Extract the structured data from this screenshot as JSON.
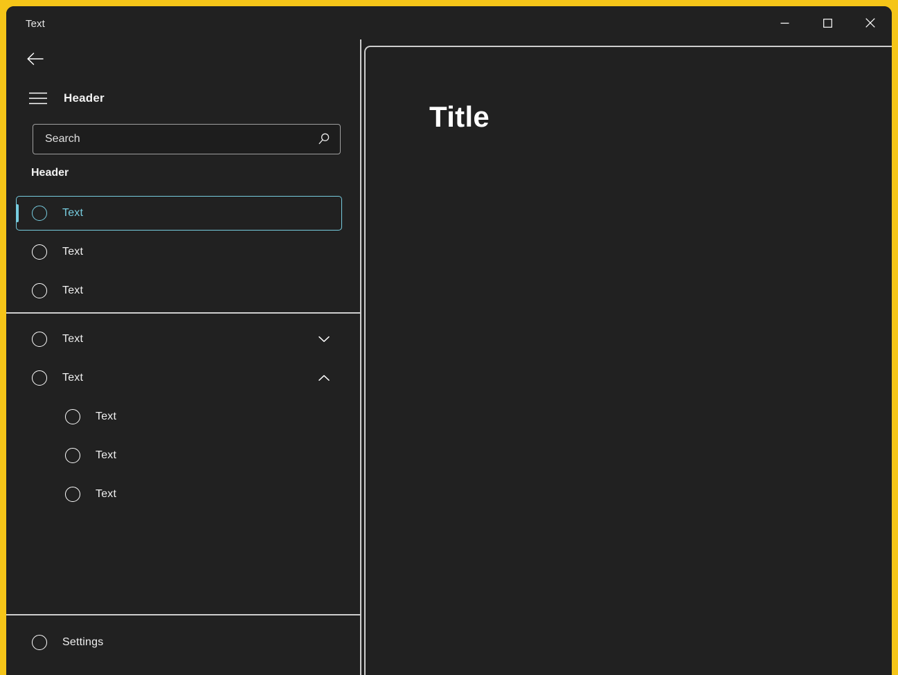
{
  "window": {
    "title": "Text",
    "frame_color": "#f5c518",
    "background": "#212121",
    "accent_color": "#77cde0",
    "border_color": "#cfcfcf",
    "caption_buttons": [
      {
        "name": "minimize",
        "icon": "minimize-icon",
        "label": "Minimize"
      },
      {
        "name": "maximize",
        "icon": "maximize-icon",
        "label": "Maximize"
      },
      {
        "name": "close",
        "icon": "close-icon",
        "label": "Close"
      }
    ]
  },
  "sidebar": {
    "back_button": {
      "icon": "back-arrow-icon",
      "label": "Back"
    },
    "hamburger_button": {
      "icon": "hamburger-icon",
      "label": "Navigation"
    },
    "nav_header": "Header",
    "search": {
      "placeholder": "Search",
      "value": "",
      "icon": "search-icon"
    },
    "section_header": "Header",
    "primary_items": [
      {
        "label": "Text",
        "icon": "circle-icon",
        "selected": true,
        "expandable": false
      },
      {
        "label": "Text",
        "icon": "circle-icon",
        "selected": false,
        "expandable": false
      },
      {
        "label": "Text",
        "icon": "circle-icon",
        "selected": false,
        "expandable": false
      }
    ],
    "secondary_items": [
      {
        "label": "Text",
        "icon": "circle-icon",
        "selected": false,
        "expandable": true,
        "expanded": false,
        "chevron": "chevron-down-icon"
      },
      {
        "label": "Text",
        "icon": "circle-icon",
        "selected": false,
        "expandable": true,
        "expanded": true,
        "chevron": "chevron-up-icon"
      }
    ],
    "child_items": [
      {
        "label": "Text",
        "icon": "circle-icon"
      },
      {
        "label": "Text",
        "icon": "circle-icon"
      },
      {
        "label": "Text",
        "icon": "circle-icon"
      }
    ],
    "footer_items": [
      {
        "label": "Settings",
        "icon": "circle-icon"
      }
    ]
  },
  "content": {
    "title": "Title"
  }
}
